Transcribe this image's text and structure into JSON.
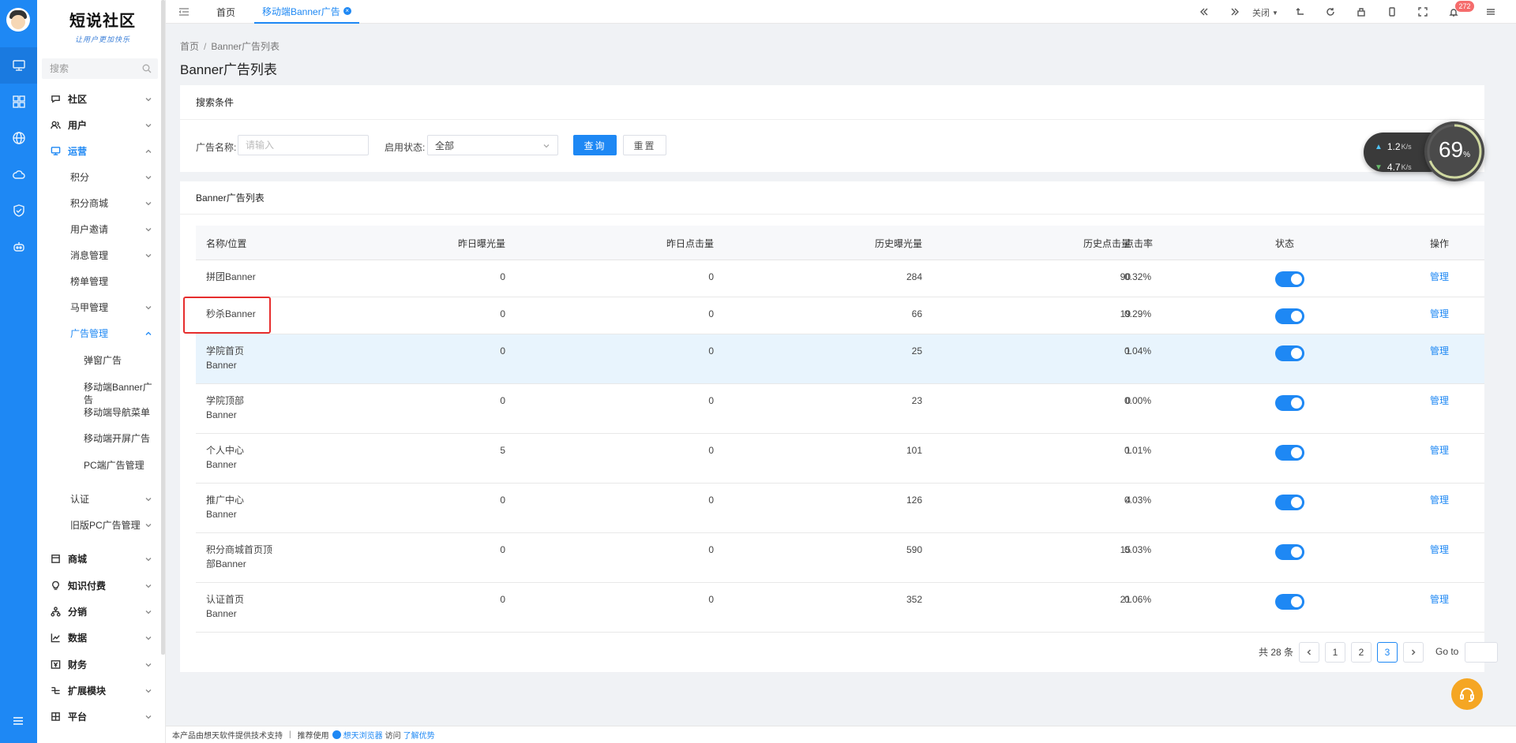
{
  "logo": {
    "title": "短说社区",
    "slogan": "让用户更加快乐"
  },
  "sidebar": {
    "search_placeholder": "搜索",
    "menus": [
      {
        "label": "社区",
        "icon": "chat-icon",
        "open": false
      },
      {
        "label": "用户",
        "icon": "users-icon",
        "open": false
      },
      {
        "label": "运营",
        "icon": "monitor-icon",
        "open": true
      },
      {
        "label": "商城",
        "icon": "shop-icon",
        "open": false
      },
      {
        "label": "知识付费",
        "icon": "bulb-icon",
        "open": false
      },
      {
        "label": "分销",
        "icon": "share-icon",
        "open": false
      },
      {
        "label": "数据",
        "icon": "chart-icon",
        "open": false
      },
      {
        "label": "财务",
        "icon": "finance-icon",
        "open": false
      },
      {
        "label": "扩展模块",
        "icon": "extension-icon",
        "open": false
      },
      {
        "label": "平台",
        "icon": "platform-icon",
        "open": false
      }
    ],
    "ops_submenu": [
      {
        "label": "积分",
        "has_children": true
      },
      {
        "label": "积分商城",
        "has_children": true
      },
      {
        "label": "用户邀请",
        "has_children": true
      },
      {
        "label": "消息管理",
        "has_children": true
      },
      {
        "label": "榜单管理",
        "has_children": false
      },
      {
        "label": "马甲管理",
        "has_children": true
      },
      {
        "label": "广告管理",
        "has_children": true,
        "open": true
      },
      {
        "label": "认证",
        "has_children": true
      },
      {
        "label": "旧版PC广告管理",
        "has_children": true
      }
    ],
    "ad_submenu": [
      "弹窗广告",
      "移动端Banner广告",
      "移动端导航菜单",
      "移动端开屏广告",
      "PC端广告管理"
    ]
  },
  "topbar": {
    "tabs": [
      {
        "label": "首页",
        "active": false
      },
      {
        "label": "移动端Banner广告",
        "active": true
      }
    ],
    "close_label": "关闭",
    "notification_count": "272"
  },
  "breadcrumb": {
    "home": "首页",
    "current": "Banner广告列表"
  },
  "page_title": "Banner广告列表",
  "search_card": {
    "title": "搜索条件",
    "name_label": "广告名称:",
    "name_placeholder": "请输入",
    "status_label": "启用状态:",
    "status_value": "全部",
    "query_button": "查询",
    "reset_button": "重置"
  },
  "list_card": {
    "title": "Banner广告列表",
    "columns": [
      "名称/位置",
      "昨日曝光量",
      "昨日点击量",
      "历史曝光量",
      "历史点击量",
      "点击率",
      "状态",
      "操作"
    ],
    "rows": [
      {
        "name": "拼团Banner",
        "y_exposure": "0",
        "y_clicks": "0",
        "h_exposure": "284",
        "h_clicks": "90",
        "ctr": "0.32%",
        "enabled": true,
        "action": "管理"
      },
      {
        "name": "秒杀Banner",
        "y_exposure": "0",
        "y_clicks": "0",
        "h_exposure": "66",
        "h_clicks": "19",
        "ctr": "0.29%",
        "enabled": true,
        "action": "管理"
      },
      {
        "name": "学院首页\nBanner",
        "y_exposure": "0",
        "y_clicks": "0",
        "h_exposure": "25",
        "h_clicks": "1",
        "ctr": "0.04%",
        "enabled": true,
        "action": "管理"
      },
      {
        "name": "学院顶部\nBanner",
        "y_exposure": "0",
        "y_clicks": "0",
        "h_exposure": "23",
        "h_clicks": "0",
        "ctr": "0.00%",
        "enabled": true,
        "action": "管理"
      },
      {
        "name": "个人中心\nBanner",
        "y_exposure": "5",
        "y_clicks": "0",
        "h_exposure": "101",
        "h_clicks": "1",
        "ctr": "0.01%",
        "enabled": true,
        "action": "管理"
      },
      {
        "name": "推广中心\nBanner",
        "y_exposure": "0",
        "y_clicks": "0",
        "h_exposure": "126",
        "h_clicks": "4",
        "ctr": "0.03%",
        "enabled": true,
        "action": "管理"
      },
      {
        "name": "积分商城首页顶\n部Banner",
        "y_exposure": "0",
        "y_clicks": "0",
        "h_exposure": "590",
        "h_clicks": "15",
        "ctr": "0.03%",
        "enabled": true,
        "action": "管理"
      },
      {
        "name": "认证首页\nBanner",
        "y_exposure": "0",
        "y_clicks": "0",
        "h_exposure": "352",
        "h_clicks": "21",
        "ctr": "0.06%",
        "enabled": true,
        "action": "管理"
      }
    ]
  },
  "pagination": {
    "total": "共 28 条",
    "pages": [
      "1",
      "2",
      "3"
    ],
    "current": "3",
    "goto_label": "Go to"
  },
  "speed_widget": {
    "up": "1.2",
    "down": "4.7",
    "unit": "K/s",
    "percent": "69",
    "percent_sign": "%",
    "percent_fraction": 0.69
  },
  "footer": {
    "powered": "本产品由想天软件提供技术支持",
    "recommend": "推荐使用",
    "browser": "想天浏览器",
    "visit": "访问",
    "learn": "了解优势"
  },
  "colors": {
    "primary": "#1e88f4",
    "highlight_row": "#e8f4fd",
    "annotation": "#e62e2e"
  }
}
